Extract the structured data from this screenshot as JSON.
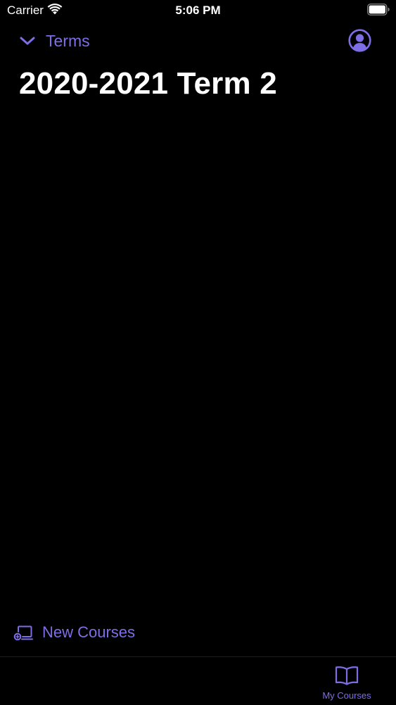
{
  "status_bar": {
    "carrier": "Carrier",
    "time": "5:06 PM"
  },
  "nav": {
    "back_label": "Terms",
    "back_icon": "chevron-down-icon",
    "profile_icon": "person-circle-icon"
  },
  "page": {
    "title": "2020-2021 Term 2"
  },
  "footer_action": {
    "label": "New Courses",
    "icon": "new-courses-icon"
  },
  "tab_bar": {
    "items": [
      {
        "label": "My Courses",
        "icon": "book-icon",
        "selected": true
      }
    ]
  },
  "colors": {
    "background": "#000000",
    "accent": "#7e6ee6",
    "text_primary": "#ffffff"
  }
}
